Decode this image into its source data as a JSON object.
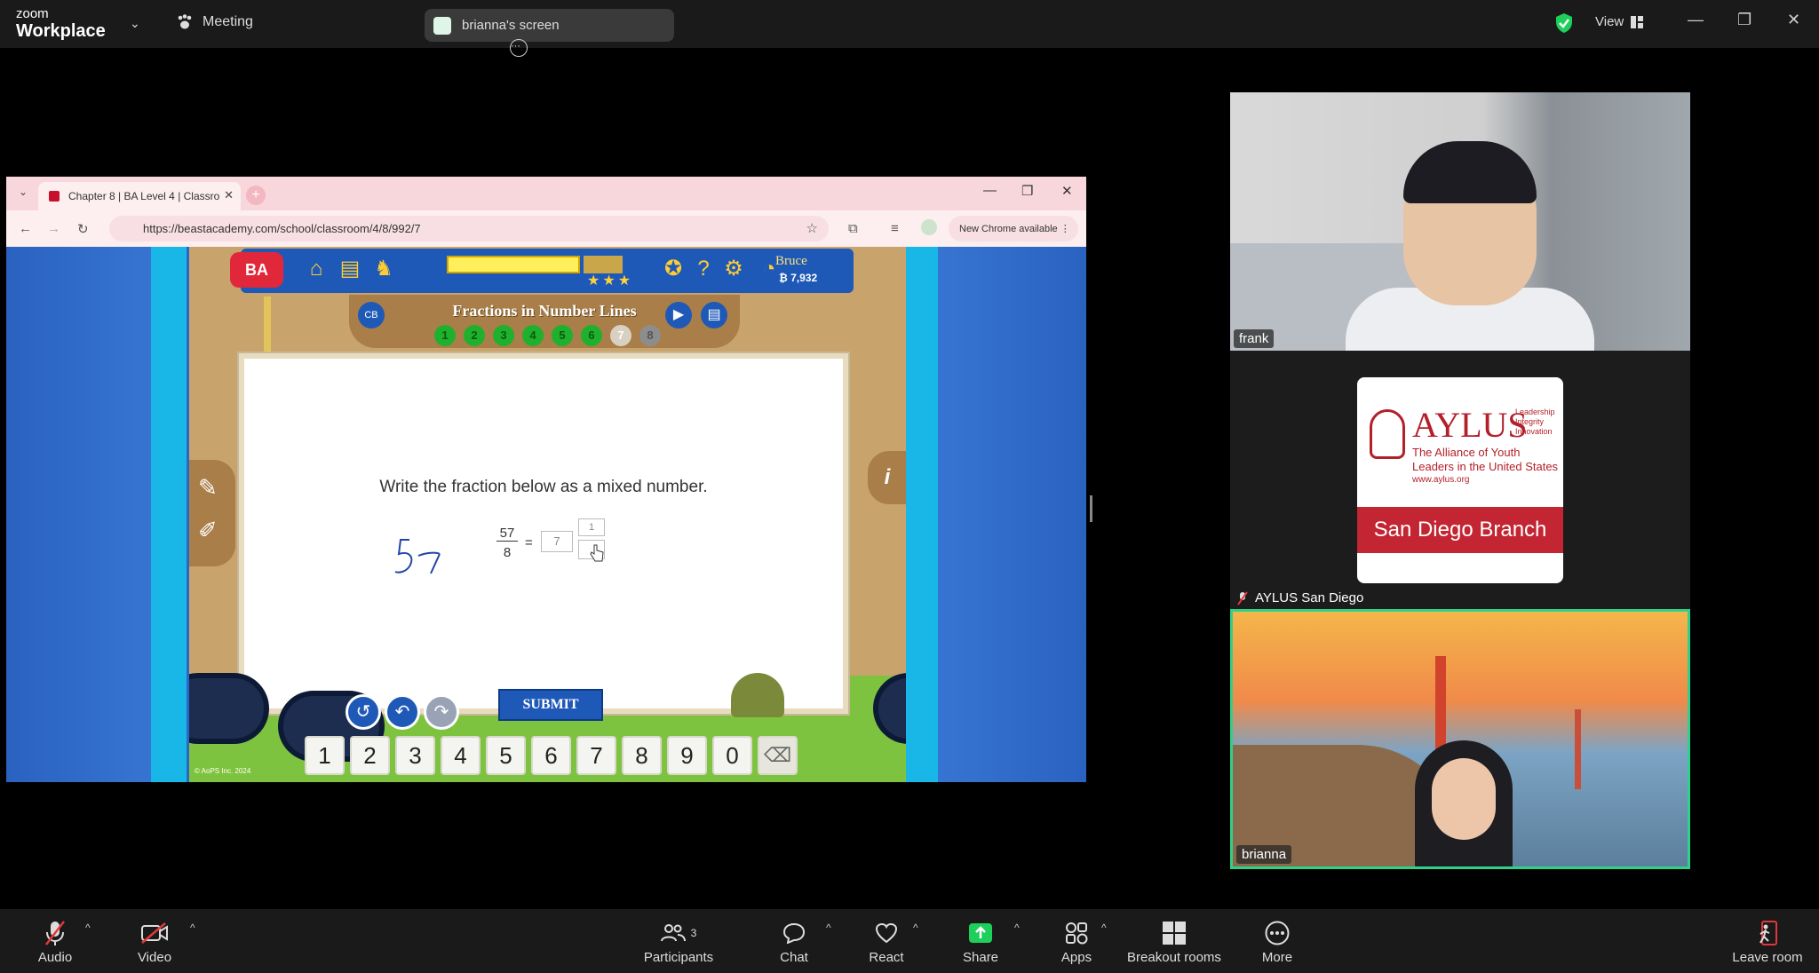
{
  "topbar": {
    "logo_line1": "zoom",
    "logo_line2": "Workplace",
    "meeting_label": "Meeting",
    "share_chip": "brianna's screen",
    "view_label": "View"
  },
  "browser": {
    "tab_title": "Chapter 8 | BA Level 4 | Classro",
    "url": "https://beastacademy.com/school/classroom/4/8/992/7",
    "chrome_update": "New Chrome available"
  },
  "game": {
    "logo": "BA",
    "player_name": "Bruce",
    "coins": "₿ 7,932",
    "lesson_title": "Fractions in Number Lines",
    "lesson_dots": [
      "1",
      "2",
      "3",
      "4",
      "5",
      "6",
      "7",
      "8"
    ],
    "current_dot": "7",
    "question": "Write the fraction below as a mixed number.",
    "fraction_numerator": "57",
    "fraction_denominator": "8",
    "equals": "=",
    "whole_box": "7",
    "num_box": "1",
    "submit_label": "SUBMIT",
    "keypad": [
      "1",
      "2",
      "3",
      "4",
      "5",
      "6",
      "7",
      "8",
      "9",
      "0"
    ],
    "copyright": "© AoPS Inc. 2024"
  },
  "participants_panel": {
    "frank_label": "frank",
    "aylus_title": "AYLUS",
    "aylus_tagline": "Leadership Integrity Innovation",
    "aylus_alliance": "The Alliance of Youth Leaders in the United States",
    "aylus_url": "www.aylus.org",
    "aylus_branch": "San Diego Branch",
    "aylus_label": "AYLUS San Diego",
    "brianna_label": "brianna"
  },
  "bottombar": {
    "audio": "Audio",
    "video": "Video",
    "participants": "Participants",
    "participants_count": "3",
    "chat": "Chat",
    "react": "React",
    "share": "Share",
    "apps": "Apps",
    "breakout": "Breakout rooms",
    "more": "More",
    "leave": "Leave room"
  },
  "colors": {
    "share_green": "#1fcf5c",
    "active_border": "#2fd18a",
    "muted_red": "#e0383a"
  }
}
